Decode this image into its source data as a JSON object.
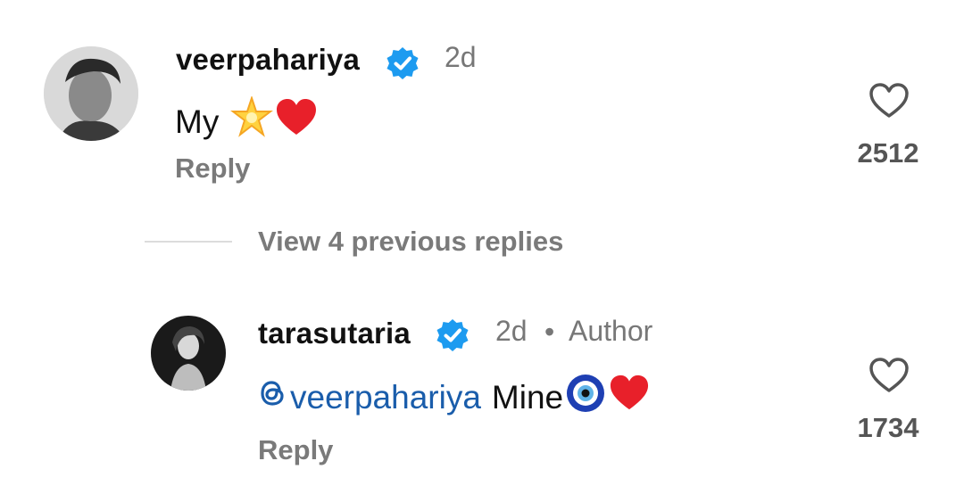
{
  "comment": {
    "username": "veerpahariya",
    "time": "2d",
    "text_prefix": "My",
    "emoji_icons": [
      "glowing-star-icon",
      "red-heart-icon"
    ],
    "reply_label": "Reply",
    "like_count": "2512",
    "verified": true
  },
  "view_replies_label": "View 4 previous replies",
  "reply_comment": {
    "username": "tarasutaria",
    "time": "2d",
    "separator": "•",
    "author_label": "Author",
    "mention": "veerpahariya",
    "text": "Mine",
    "emoji_icons": [
      "nazar-amulet-icon",
      "red-heart-icon"
    ],
    "reply_label": "Reply",
    "like_count": "1734",
    "verified": true
  },
  "colors": {
    "verified_badge": "#1d9bf0",
    "mention": "#1a5dab",
    "muted_text": "#7a7a7a"
  }
}
